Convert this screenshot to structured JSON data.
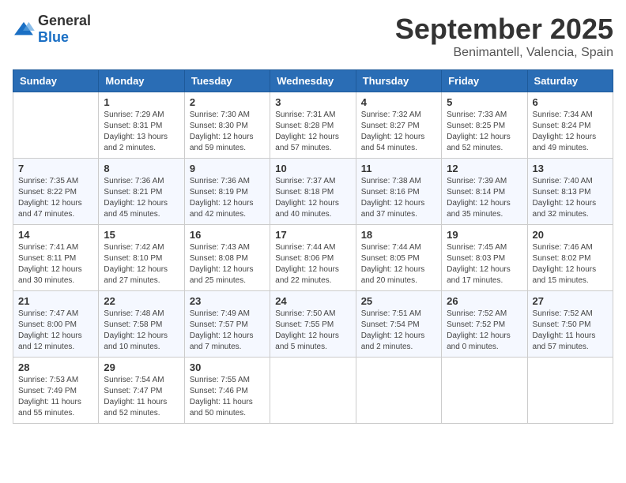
{
  "logo": {
    "general": "General",
    "blue": "Blue"
  },
  "header": {
    "month": "September 2025",
    "location": "Benimantell, Valencia, Spain"
  },
  "weekdays": [
    "Sunday",
    "Monday",
    "Tuesday",
    "Wednesday",
    "Thursday",
    "Friday",
    "Saturday"
  ],
  "weeks": [
    [
      {
        "day": "",
        "info": ""
      },
      {
        "day": "1",
        "info": "Sunrise: 7:29 AM\nSunset: 8:31 PM\nDaylight: 13 hours\nand 2 minutes."
      },
      {
        "day": "2",
        "info": "Sunrise: 7:30 AM\nSunset: 8:30 PM\nDaylight: 12 hours\nand 59 minutes."
      },
      {
        "day": "3",
        "info": "Sunrise: 7:31 AM\nSunset: 8:28 PM\nDaylight: 12 hours\nand 57 minutes."
      },
      {
        "day": "4",
        "info": "Sunrise: 7:32 AM\nSunset: 8:27 PM\nDaylight: 12 hours\nand 54 minutes."
      },
      {
        "day": "5",
        "info": "Sunrise: 7:33 AM\nSunset: 8:25 PM\nDaylight: 12 hours\nand 52 minutes."
      },
      {
        "day": "6",
        "info": "Sunrise: 7:34 AM\nSunset: 8:24 PM\nDaylight: 12 hours\nand 49 minutes."
      }
    ],
    [
      {
        "day": "7",
        "info": "Sunrise: 7:35 AM\nSunset: 8:22 PM\nDaylight: 12 hours\nand 47 minutes."
      },
      {
        "day": "8",
        "info": "Sunrise: 7:36 AM\nSunset: 8:21 PM\nDaylight: 12 hours\nand 45 minutes."
      },
      {
        "day": "9",
        "info": "Sunrise: 7:36 AM\nSunset: 8:19 PM\nDaylight: 12 hours\nand 42 minutes."
      },
      {
        "day": "10",
        "info": "Sunrise: 7:37 AM\nSunset: 8:18 PM\nDaylight: 12 hours\nand 40 minutes."
      },
      {
        "day": "11",
        "info": "Sunrise: 7:38 AM\nSunset: 8:16 PM\nDaylight: 12 hours\nand 37 minutes."
      },
      {
        "day": "12",
        "info": "Sunrise: 7:39 AM\nSunset: 8:14 PM\nDaylight: 12 hours\nand 35 minutes."
      },
      {
        "day": "13",
        "info": "Sunrise: 7:40 AM\nSunset: 8:13 PM\nDaylight: 12 hours\nand 32 minutes."
      }
    ],
    [
      {
        "day": "14",
        "info": "Sunrise: 7:41 AM\nSunset: 8:11 PM\nDaylight: 12 hours\nand 30 minutes."
      },
      {
        "day": "15",
        "info": "Sunrise: 7:42 AM\nSunset: 8:10 PM\nDaylight: 12 hours\nand 27 minutes."
      },
      {
        "day": "16",
        "info": "Sunrise: 7:43 AM\nSunset: 8:08 PM\nDaylight: 12 hours\nand 25 minutes."
      },
      {
        "day": "17",
        "info": "Sunrise: 7:44 AM\nSunset: 8:06 PM\nDaylight: 12 hours\nand 22 minutes."
      },
      {
        "day": "18",
        "info": "Sunrise: 7:44 AM\nSunset: 8:05 PM\nDaylight: 12 hours\nand 20 minutes."
      },
      {
        "day": "19",
        "info": "Sunrise: 7:45 AM\nSunset: 8:03 PM\nDaylight: 12 hours\nand 17 minutes."
      },
      {
        "day": "20",
        "info": "Sunrise: 7:46 AM\nSunset: 8:02 PM\nDaylight: 12 hours\nand 15 minutes."
      }
    ],
    [
      {
        "day": "21",
        "info": "Sunrise: 7:47 AM\nSunset: 8:00 PM\nDaylight: 12 hours\nand 12 minutes."
      },
      {
        "day": "22",
        "info": "Sunrise: 7:48 AM\nSunset: 7:58 PM\nDaylight: 12 hours\nand 10 minutes."
      },
      {
        "day": "23",
        "info": "Sunrise: 7:49 AM\nSunset: 7:57 PM\nDaylight: 12 hours\nand 7 minutes."
      },
      {
        "day": "24",
        "info": "Sunrise: 7:50 AM\nSunset: 7:55 PM\nDaylight: 12 hours\nand 5 minutes."
      },
      {
        "day": "25",
        "info": "Sunrise: 7:51 AM\nSunset: 7:54 PM\nDaylight: 12 hours\nand 2 minutes."
      },
      {
        "day": "26",
        "info": "Sunrise: 7:52 AM\nSunset: 7:52 PM\nDaylight: 12 hours\nand 0 minutes."
      },
      {
        "day": "27",
        "info": "Sunrise: 7:52 AM\nSunset: 7:50 PM\nDaylight: 11 hours\nand 57 minutes."
      }
    ],
    [
      {
        "day": "28",
        "info": "Sunrise: 7:53 AM\nSunset: 7:49 PM\nDaylight: 11 hours\nand 55 minutes."
      },
      {
        "day": "29",
        "info": "Sunrise: 7:54 AM\nSunset: 7:47 PM\nDaylight: 11 hours\nand 52 minutes."
      },
      {
        "day": "30",
        "info": "Sunrise: 7:55 AM\nSunset: 7:46 PM\nDaylight: 11 hours\nand 50 minutes."
      },
      {
        "day": "",
        "info": ""
      },
      {
        "day": "",
        "info": ""
      },
      {
        "day": "",
        "info": ""
      },
      {
        "day": "",
        "info": ""
      }
    ]
  ]
}
